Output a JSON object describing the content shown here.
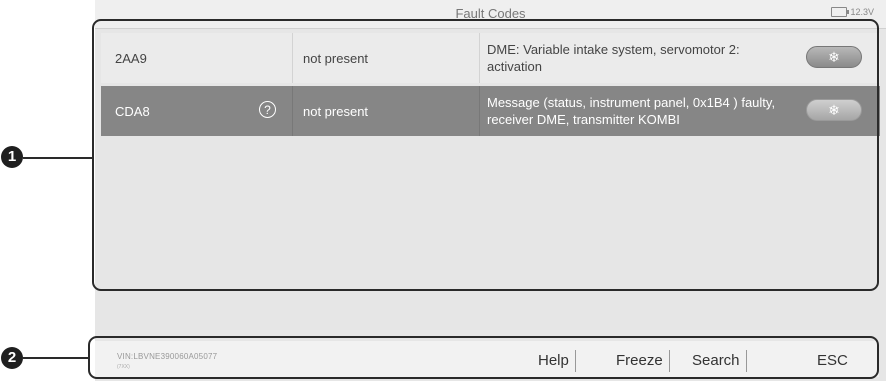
{
  "header": {
    "title": "Fault Codes",
    "battery": "12.3V"
  },
  "faults": [
    {
      "code": "2AA9",
      "status": "not present",
      "description": "DME: Variable intake system, servomotor 2: activation",
      "help": false,
      "freeze_icon": "❄"
    },
    {
      "code": "CDA8",
      "status": "not present",
      "description": "Message (status, instrument panel, 0x1B4 ) faulty, receiver DME, transmitter KOMBI",
      "help": true,
      "help_icon": "?",
      "freeze_icon": "❄"
    }
  ],
  "footer": {
    "vin": "VIN:LBVNE390060A05077",
    "vin_sub": "(7XX)",
    "buttons": {
      "help": "Help",
      "freeze": "Freeze",
      "search": "Search",
      "esc": "ESC"
    }
  },
  "callouts": {
    "one": "1",
    "two": "2"
  }
}
